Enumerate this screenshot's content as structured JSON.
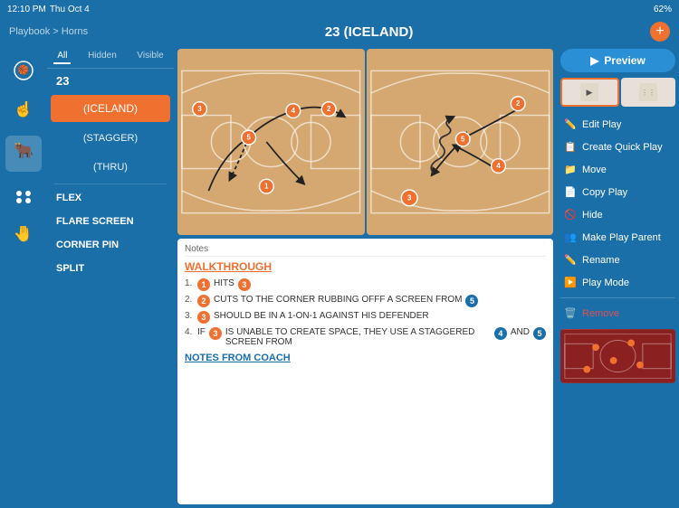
{
  "statusBar": {
    "time": "12:10 PM",
    "day": "Thu Oct 4",
    "battery": "62%",
    "batteryIcon": "🔋"
  },
  "navBar": {
    "breadcrumb": "Playbook > Horns",
    "title": "23 (ICELAND)",
    "addButton": "+"
  },
  "playListTabs": [
    "All",
    "Hidden",
    "Visible"
  ],
  "activeTab": "All",
  "playNumber": "23",
  "plays": [
    {
      "id": "iceland",
      "label": "(ICELAND)",
      "active": true
    },
    {
      "id": "stagger",
      "label": "(STAGGER)",
      "active": false
    },
    {
      "id": "thru",
      "label": "(THRU)",
      "active": false
    }
  ],
  "playItems": [
    {
      "id": "flex",
      "label": "FLEX"
    },
    {
      "id": "flare",
      "label": "FLARE SCREEN"
    },
    {
      "id": "corner",
      "label": "CORNER PIN"
    },
    {
      "id": "split",
      "label": "SPLIT"
    }
  ],
  "notesLabel": "Notes",
  "walkthroughTitle": "WALKTHROUGH",
  "walkthroughSteps": [
    {
      "num": 1,
      "text": " HITS ",
      "player1": "1",
      "player2": "3"
    },
    {
      "num": 2,
      "text": " CUTS TO THE CORNER RUBBING OFFF A SCREEN FROM ",
      "player1": "2",
      "player2": "5"
    },
    {
      "num": 3,
      "text": " SHOULD BE IN A 1-ON-1 AGAINST HIS DEFENDER",
      "player1": "3"
    },
    {
      "num": 4,
      "text": " IS UNABLE TO CREATE SPACE, THEY USE A STAGGERED SCREEN FROM  AND ",
      "player1": "3",
      "player2": "4",
      "player3": "5"
    }
  ],
  "notesFromCoach": "NOTES FROM COACH",
  "rightMenu": {
    "previewLabel": "Preview",
    "items": [
      {
        "id": "edit-play",
        "icon": "✏️",
        "label": "Edit Play"
      },
      {
        "id": "create-quick-play",
        "icon": "📋",
        "label": "Create Quick Play"
      },
      {
        "id": "move",
        "icon": "📁",
        "label": "Move"
      },
      {
        "id": "copy-play",
        "icon": "📄",
        "label": "Copy Play"
      },
      {
        "id": "hide",
        "icon": "🚫",
        "label": "Hide"
      },
      {
        "id": "make-play-parent",
        "icon": "👥",
        "label": "Make Play Parent"
      },
      {
        "id": "rename",
        "icon": "✏️",
        "label": "Rename"
      },
      {
        "id": "play-mode",
        "icon": "▶️",
        "label": "Play Mode"
      },
      {
        "id": "remove",
        "icon": "🗑️",
        "label": "Remove",
        "danger": true
      }
    ]
  }
}
